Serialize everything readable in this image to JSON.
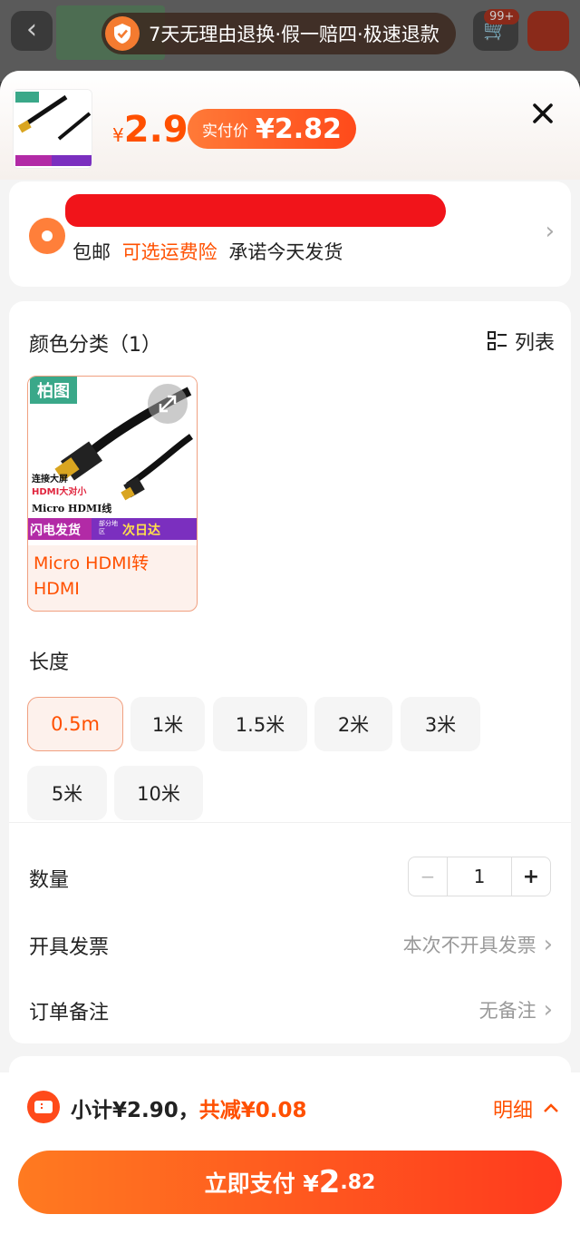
{
  "background": {
    "cart_badge": "99+"
  },
  "guarantee": {
    "text": "7天无理由退换·假一赔四·极速退款"
  },
  "header": {
    "price_symbol": "¥",
    "price": "2.9",
    "pay_label": "实付价",
    "pay_value": "¥2.82"
  },
  "address": {
    "shipping": "包邮",
    "insurance_link": "可选运费险",
    "promise": "承诺今天发货"
  },
  "options": {
    "color_title": "颜色分类（1）",
    "list_toggle_label": "列表",
    "sku": {
      "brand": "柏图",
      "img_lines": [
        "连接大屏",
        "HDMI大对小",
        "Micro HDMI线"
      ],
      "banner_left": "闪电发货",
      "banner_mid": "部分地区",
      "banner_right": "次日达",
      "name": "Micro HDMI转HDMI"
    },
    "length_title": "长度",
    "lengths": [
      "0.5m",
      "1米",
      "1.5米",
      "2米",
      "3米",
      "5米",
      "10米"
    ]
  },
  "quantity": {
    "label": "数量",
    "minus": "−",
    "value": "1",
    "plus": "+"
  },
  "invoice": {
    "label": "开具发票",
    "value": "本次不开具发票"
  },
  "remark": {
    "label": "订单备注",
    "value": "无备注"
  },
  "footer": {
    "subtotal": "小计¥2.90，",
    "saved": "共减¥0.08",
    "detail": "明细",
    "pay_label": "立即支付 ¥",
    "pay_int": "2",
    "pay_dec": ".82"
  },
  "colors": {
    "accent": "#ff5000",
    "selected_bg": "#fdf1ec"
  }
}
